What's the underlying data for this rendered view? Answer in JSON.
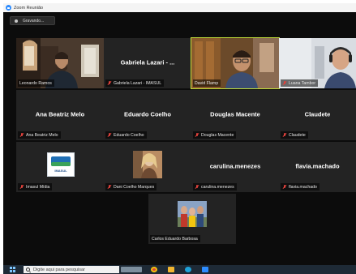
{
  "window": {
    "title": "Zoom Reunião"
  },
  "recording": {
    "label": "Gravando..."
  },
  "participants": [
    {
      "label": "Leonardo Ramos",
      "center_name": "",
      "muted": false,
      "video": true
    },
    {
      "label": "Gabriela Lazari - IMASUL",
      "center_name": "Gabriela Lazari - ...",
      "muted": true,
      "video": false
    },
    {
      "label": "David Flamp",
      "center_name": "",
      "muted": false,
      "video": true,
      "active_speaker": true
    },
    {
      "label": "Luana Tambor",
      "center_name": "",
      "muted": true,
      "video": true
    },
    {
      "label": "Ana Beatriz Melo",
      "center_name": "Ana Beatriz Melo",
      "muted": true,
      "video": false
    },
    {
      "label": "Eduardo Coelho",
      "center_name": "Eduardo Coelho",
      "muted": true,
      "video": false
    },
    {
      "label": "Douglas Macente",
      "center_name": "Douglas Macente",
      "muted": true,
      "video": false
    },
    {
      "label": "Claudete",
      "center_name": "Claudete",
      "muted": true,
      "video": false
    },
    {
      "label": "Imasul Mídia",
      "center_name": "",
      "muted": true,
      "video": false,
      "avatar": "imasul-logo",
      "logo_text": "IMASUL"
    },
    {
      "label": "Dani Coelho Marques",
      "center_name": "",
      "muted": true,
      "video": false,
      "avatar": "profile-photo"
    },
    {
      "label": "carulina.menezes",
      "center_name": "carulina.menezes",
      "muted": true,
      "video": false
    },
    {
      "label": "flavia.machado",
      "center_name": "flavia.machado",
      "muted": true,
      "video": false
    },
    {
      "label": "Carlos Eduardo Barbosa",
      "center_name": "",
      "muted": false,
      "video": false,
      "avatar": "group-photo"
    }
  ],
  "taskbar": {
    "search_placeholder": "Digite aqui para pesquisar"
  },
  "colors": {
    "active_speaker_border": "#c3e23a",
    "muted_icon": "#e0413c",
    "tile_bg": "#232323",
    "window_bg": "#0c0c0c"
  }
}
